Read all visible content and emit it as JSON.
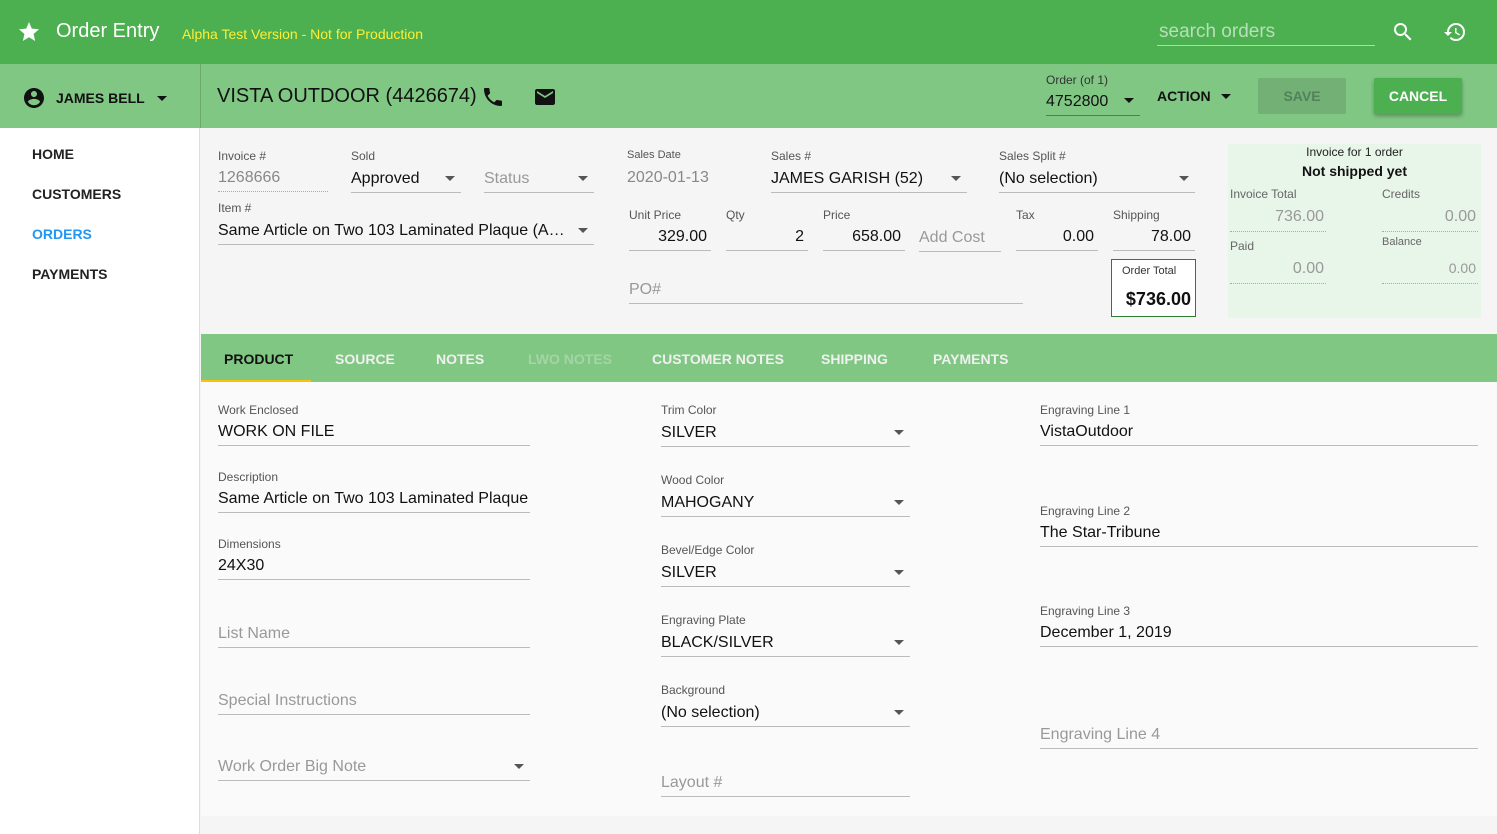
{
  "appbar": {
    "title": "Order Entry",
    "alpha_notice": "Alpha Test Version - Not for Production",
    "search_placeholder": "search orders",
    "icons": [
      "star-icon",
      "search-icon",
      "history-icon"
    ]
  },
  "user": {
    "name": "JAMES BELL"
  },
  "customer": {
    "name": "VISTA OUTDOOR (4426674)"
  },
  "order": {
    "label": "Order (of 1)",
    "number": "4752800"
  },
  "toolbar": {
    "action_label": "ACTION",
    "save_label": "SAVE",
    "cancel_label": "CANCEL"
  },
  "nav": {
    "items": [
      "HOME",
      "CUSTOMERS",
      "ORDERS",
      "PAYMENTS"
    ],
    "active": "ORDERS"
  },
  "form": {
    "invoice_label": "Invoice #",
    "invoice_value": "1268666",
    "sold_label": "Sold",
    "sold_value": "Approved",
    "status_placeholder": "Status",
    "sales_date_label": "Sales Date",
    "sales_date_value": "2020-01-13",
    "sales_num_label": "Sales #",
    "sales_num_value": "JAMES GARISH (52)",
    "sales_split_label": "Sales Split #",
    "sales_split_value": "(No selection)",
    "item_label": "Item #",
    "item_value": "Same Article on Two 103 Laminated Plaque (A…",
    "unit_price_label": "Unit Price",
    "unit_price_value": "329.00",
    "qty_label": "Qty",
    "qty_value": "2",
    "price_label": "Price",
    "price_value": "658.00",
    "add_cost_placeholder": "Add Cost",
    "tax_label": "Tax",
    "tax_value": "0.00",
    "shipping_label": "Shipping",
    "shipping_value": "78.00",
    "po_placeholder": "PO#",
    "order_total_label": "Order Total",
    "order_total_value": "$736.00"
  },
  "invoice_panel": {
    "title": "Invoice for 1 order",
    "status": "Not shipped yet",
    "invoice_total_label": "Invoice Total",
    "invoice_total_value": "736.00",
    "credits_label": "Credits",
    "credits_value": "0.00",
    "paid_label": "Paid",
    "paid_value": "0.00",
    "balance_label": "Balance",
    "balance_value": "0.00"
  },
  "tabs": [
    {
      "label": "PRODUCT",
      "state": "active"
    },
    {
      "label": "SOURCE",
      "state": "normal"
    },
    {
      "label": "NOTES",
      "state": "normal"
    },
    {
      "label": "LWO NOTES",
      "state": "disabled"
    },
    {
      "label": "CUSTOMER NOTES",
      "state": "normal"
    },
    {
      "label": "SHIPPING",
      "state": "normal"
    },
    {
      "label": "PAYMENTS",
      "state": "normal"
    }
  ],
  "product": {
    "work_enclosed_label": "Work Enclosed",
    "work_enclosed_value": "WORK ON FILE",
    "description_label": "Description",
    "description_value": "Same Article on Two 103 Laminated Plaque",
    "dimensions_label": "Dimensions",
    "dimensions_value": "24X30",
    "list_name_placeholder": "List Name",
    "special_instructions_placeholder": "Special Instructions",
    "work_order_big_note_placeholder": "Work Order Big Note",
    "trim_color_label": "Trim Color",
    "trim_color_value": "SILVER",
    "wood_color_label": "Wood Color",
    "wood_color_value": "MAHOGANY",
    "bevel_label": "Bevel/Edge Color",
    "bevel_value": "SILVER",
    "plate_label": "Engraving Plate",
    "plate_value": "BLACK/SILVER",
    "background_label": "Background",
    "background_value": "(No selection)",
    "layout_placeholder": "Layout #",
    "eng1_label": "Engraving Line 1",
    "eng1_value": "VistaOutdoor",
    "eng2_label": "Engraving Line 2",
    "eng2_value": "The Star-Tribune",
    "eng3_label": "Engraving Line 3",
    "eng3_value": "December 1, 2019",
    "eng4_placeholder": "Engraving Line 4"
  },
  "colors": {
    "primary": "#4caf50",
    "primary_light": "#81c784",
    "accent": "#ffc107",
    "link": "#2196f3",
    "alpha_text": "#ffee33"
  }
}
